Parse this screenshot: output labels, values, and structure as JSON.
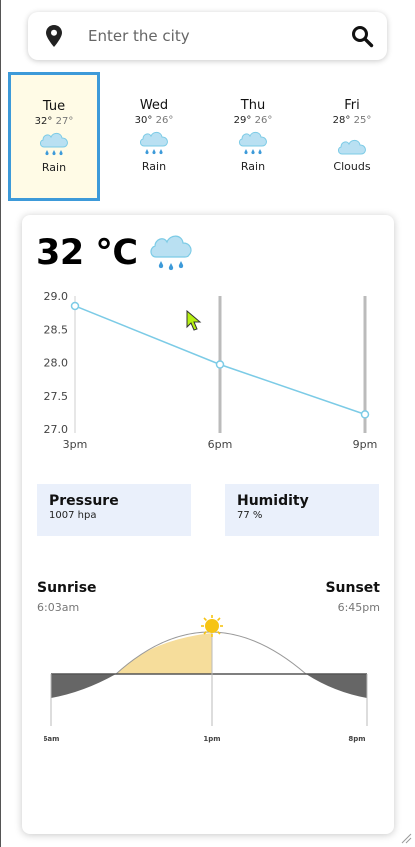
{
  "search": {
    "placeholder": "Enter the city"
  },
  "forecast": [
    {
      "day": "Tue",
      "high": "32°",
      "low": "27°",
      "condition": "Rain",
      "icon": "rain-cloud-icon",
      "selected": true
    },
    {
      "day": "Wed",
      "high": "30°",
      "low": "26°",
      "condition": "Rain",
      "icon": "rain-cloud-icon",
      "selected": false
    },
    {
      "day": "Thu",
      "high": "29°",
      "low": "26°",
      "condition": "Rain",
      "icon": "rain-cloud-icon",
      "selected": false
    },
    {
      "day": "Fri",
      "high": "28°",
      "low": "25°",
      "condition": "Clouds",
      "icon": "cloud-icon",
      "selected": false
    }
  ],
  "current": {
    "temperature": "32 °C",
    "icon": "rain-cloud-icon"
  },
  "chart_data": {
    "type": "line",
    "x": [
      "3pm",
      "6pm",
      "9pm"
    ],
    "series": [
      {
        "values": [
          28.85,
          27.97,
          27.22
        ]
      }
    ],
    "yticks": [
      "29.0",
      "28.5",
      "28.0",
      "27.5",
      "27.0"
    ],
    "ylim": [
      27.0,
      29.0
    ],
    "grid": "vertical",
    "color": "#7ccbe6"
  },
  "details": {
    "pressure": {
      "label": "Pressure",
      "value": "1007 hpa"
    },
    "humidity": {
      "label": "Humidity",
      "value": "77 %"
    }
  },
  "sun": {
    "sunrise_label": "Sunrise",
    "sunrise_time": "6:03am",
    "sunset_label": "Sunset",
    "sunset_time": "6:45pm",
    "axis_labels": [
      "6am",
      "1pm",
      "8pm"
    ],
    "current_hour": 13,
    "day_start_hour": 6,
    "day_end_hour": 20
  },
  "colors": {
    "accent": "#3d9ad9",
    "selected_bg": "#fffbe6",
    "info_bg": "#eaf0fb",
    "sun_fill": "#f3d27a",
    "line": "#7ccbe6"
  }
}
